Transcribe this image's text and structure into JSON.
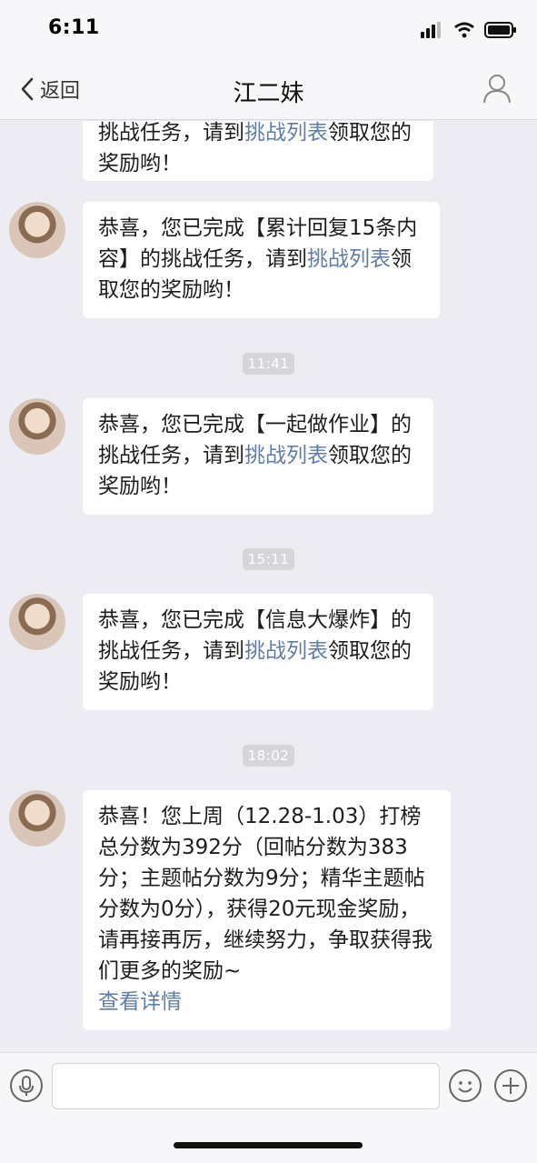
{
  "status_bar": {
    "time": "6:11"
  },
  "nav": {
    "back_label": "返回",
    "title": "江二妹"
  },
  "messages": [
    {
      "before": "挑战任务，请到",
      "link": "挑战列表",
      "after": "领取您的奖励哟！"
    },
    {
      "before": "恭喜，您已完成【累计回复15条内容】的挑战任务，请到",
      "link": "挑战列表",
      "after": "领取您的奖励哟！"
    },
    {
      "before": "恭喜，您已完成【一起做作业】的挑战任务，请到",
      "link": "挑战列表",
      "after": "领取您的奖励哟！"
    },
    {
      "before": "恭喜，您已完成【信息大爆炸】的挑战任务，请到",
      "link": "挑战列表",
      "after": "领取您的奖励哟！"
    },
    {
      "text": "恭喜！您上周（12.28-1.03）打榜总分数为392分（回帖分数为383分；主题帖分数为9分；精华主题帖分数为0分），获得20元现金奖励，请再接再厉，继续努力，争取获得我们更多的奖励~",
      "link": "查看详情"
    }
  ],
  "timestamps": [
    "11:41",
    "15:11",
    "18:02"
  ],
  "input_bar": {
    "placeholder": ""
  },
  "icons": {
    "back": "chevron-left-icon",
    "profile": "person-icon",
    "voice": "microphone-icon",
    "emoji": "smiley-icon",
    "plus": "plus-icon"
  },
  "colors": {
    "link": "#5f7da6",
    "chat_background": "#ececf2",
    "bubble": "#ffffff"
  }
}
